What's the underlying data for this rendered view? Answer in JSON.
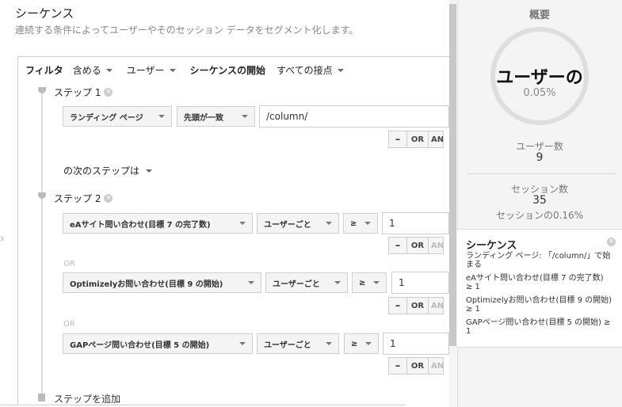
{
  "header": {
    "title": "シーケンス",
    "subtitle": "連続する条件によってユーザーやそのセッション データをセグメント化します。"
  },
  "filter": {
    "label": "フィルタ",
    "include": "含める",
    "scope": "ユーザー",
    "start_label": "シーケンスの開始",
    "start_value": "すべての接点"
  },
  "buttons": {
    "minus": "–",
    "or": "OR",
    "and": "AN"
  },
  "step1": {
    "label": "ステップ 1",
    "dimension": "ランディング ページ",
    "match": "先頭が一致",
    "value": "/column/"
  },
  "next": {
    "label": "の次のステップは"
  },
  "step2": {
    "label": "ステップ 2",
    "or_label": "OR",
    "conditions": [
      {
        "metric": "eAサイト問い合わせ(目標 7 の完了数)",
        "per": "ユーザーごと",
        "op": "≥",
        "value": "1"
      },
      {
        "metric": "Optimizelyお問い合わせ(目標 9 の開始)",
        "per": "ユーザーごと",
        "op": "≥",
        "value": "1"
      },
      {
        "metric": "GAPページ問い合わせ(目標 5 の開始)",
        "per": "ユーザーごと",
        "op": "≥",
        "value": "1"
      }
    ]
  },
  "add_step": "ステップを追加",
  "summary": {
    "title": "概要",
    "ring_text": "ユーザーの",
    "ring_percent": "0.05%",
    "ring_fraction": 0.0005,
    "users_label": "ユーザー数",
    "users_value": "9",
    "sessions_label": "セッション数",
    "sessions_value": "35",
    "sessions_pct": "セッションの0.16%"
  },
  "sequence_box": {
    "title": "シーケンス",
    "lines": [
      "ランディング ページ: 「/column/」で始まる",
      "eAサイト問い合わせ(目標 7 の完了数) ≥ 1",
      "Optimizelyお問い合わせ(目標 9 の開始) ≥ 1",
      "GAPページ問い合わせ(目標 5 の開始) ≥ 1"
    ]
  },
  "colors": {
    "panel_bg": "#f4f4f4",
    "ring": "#dedede",
    "button_bg": "#f5f5f5"
  }
}
